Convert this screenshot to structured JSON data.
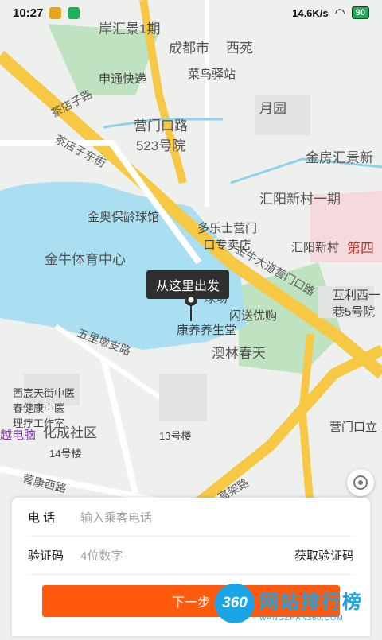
{
  "status_bar": {
    "time": "10:27",
    "speed": "14.6K/s",
    "battery": "90"
  },
  "map": {
    "labels": {
      "chengdu_city": "成都市",
      "xiyuan": "西苑",
      "anhuijingyiqi": "岸汇景1期",
      "cainiao": "菜鸟驿站",
      "shentong": "申通快递",
      "yueyuan": "月园",
      "yingmenkou_523": "营门口路\n523号院",
      "chadianzi_road": "茶店子路",
      "chadianzi_east": "茶店子东街",
      "jinfanghuijing": "金房汇景新",
      "huiyang_1": "汇阳新村一期",
      "jinao": "金奥保龄球馆",
      "duoleshi": "多乐士营门\n口专卖店",
      "huiyang": "汇阳新村",
      "disi": "第四",
      "jinniu_stadium": "金牛体育中心",
      "jinniu_dadao": "金牛大道营门口路",
      "hulixiyi": "互利西一\n巷5号院",
      "qiuchang": "球场",
      "shansong": "闪送优购",
      "kangjian": "康养养生堂",
      "aolin": "澳林春天",
      "wulidun": "五里墩支路",
      "yingmenkou_li": "营门口立",
      "xichen": "西宸天街中医\n春健康中医\n理疗工作室",
      "huacheng": "化成社区",
      "yue_pc": "越电脑",
      "building_13": "13号楼",
      "building_14": "14号楼",
      "yingxian": "营康西路",
      "gaojia": "高架路"
    },
    "pin_tooltip": "从这里出发"
  },
  "form": {
    "phone_label": "电 话",
    "phone_placeholder": "输入乘客电话",
    "code_label": "验证码",
    "code_placeholder": "4位数字",
    "get_code": "获取验证码",
    "next": "下一步"
  },
  "watermark": {
    "badge": "360",
    "title": "网站排行榜",
    "sub": "WANGZHAN360.COM"
  },
  "colors": {
    "accent": "#ff5a0e",
    "water": "#a9dff0",
    "road_yellow": "#f6c843",
    "green": "#bfe3c0"
  }
}
